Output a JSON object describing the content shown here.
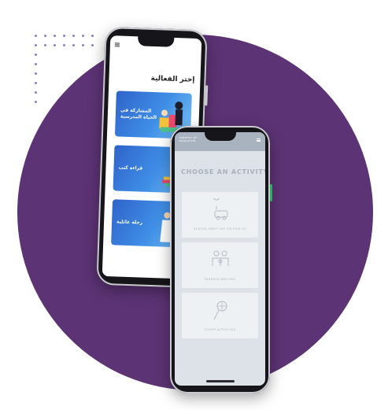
{
  "back_phone": {
    "menu_icon": "hamburger-icon",
    "title": "إختر الفعالية",
    "cards": [
      {
        "label": "المشاركة في الحياة المدرسية"
      },
      {
        "label": "قراءة كتب"
      },
      {
        "label": "رحلة عائلية"
      }
    ]
  },
  "front_phone": {
    "ministry_label": "MINISTRY OF EDUCATION",
    "menu_icon": "hamburger-icon",
    "title": "CHOOSE AN ACTIVITY",
    "options": [
      {
        "label": "SCHOOL DROP OFF OR PICK UP",
        "icon": "car-location-icon"
      },
      {
        "label": "PARENTS MEETING",
        "icon": "family-icon"
      },
      {
        "label": "OTHER ACTIVITIES",
        "icon": "basketball-icon"
      }
    ]
  },
  "colors": {
    "circle": "#5c3374",
    "card_blue": "#3f8ee6",
    "front_bg": "#dde2e8"
  }
}
